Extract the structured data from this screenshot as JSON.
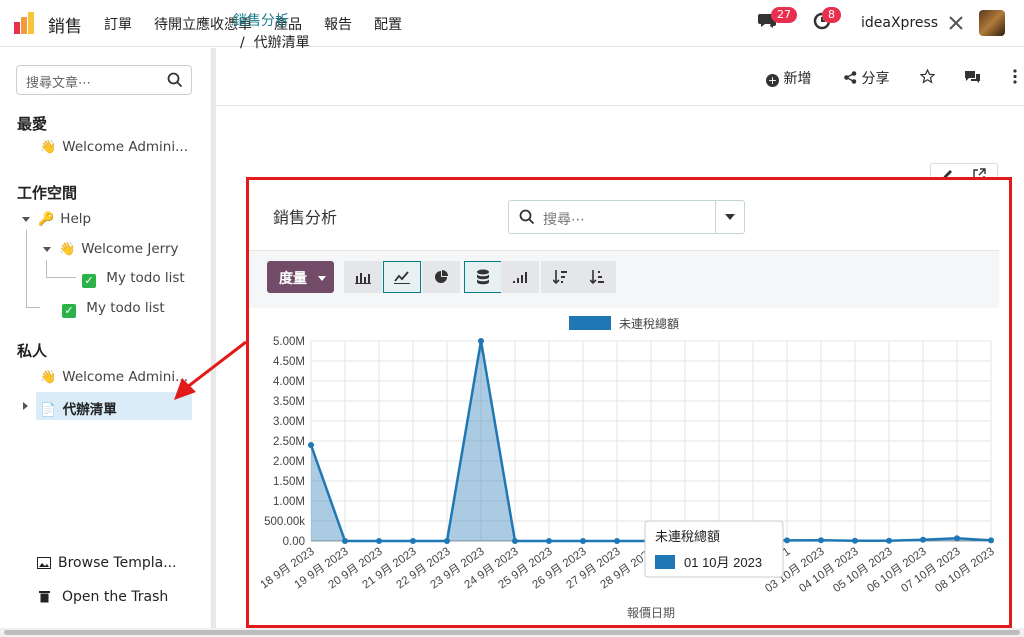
{
  "topbar": {
    "app_name": "銷售",
    "menu": [
      "訂單",
      "待開立應收憑單",
      "產品",
      "報告",
      "配置"
    ],
    "messages_count": "27",
    "activities_count": "8",
    "company": "ideaXpress"
  },
  "sidebar": {
    "search_placeholder": "搜尋文章⋯",
    "favorites_title": "最愛",
    "favorites": [
      {
        "icon": "👋",
        "label": "Welcome Admini..."
      }
    ],
    "workspace_title": "工作空間",
    "workspace": [
      {
        "icon": "🔑",
        "label": "Help"
      },
      {
        "icon": "👋",
        "label": "Welcome Jerry"
      },
      {
        "icon": "✅",
        "label": "My todo list"
      },
      {
        "icon": "✅",
        "label": "My todo list"
      }
    ],
    "private_title": "私人",
    "private": [
      {
        "icon": "👋",
        "label": "Welcome Admini..."
      },
      {
        "icon": "📄",
        "label": "代辦清單"
      }
    ],
    "browse_templates": "Browse Templa...",
    "open_trash": "Open the Trash"
  },
  "header": {
    "breadcrumb_parent": "銷售分析",
    "breadcrumb_current": "代辦清單",
    "new_label": "新增",
    "share_label": "分享"
  },
  "panel": {
    "title": "銷售分析",
    "search_placeholder": "搜尋⋯",
    "measure_label": "度量",
    "tooltip_title": "未連稅總額",
    "tooltip_value": "01 10月 2023"
  },
  "colors": {
    "series": "#1f77b4",
    "measure_button": "#714b67",
    "highlight": "#e31a1a",
    "breadcrumb": "#1a7f8c"
  },
  "chart_data": {
    "type": "area",
    "legend": "未連稅總額",
    "legend_position": "top-center",
    "xlabel": "報價日期",
    "ylabel": "",
    "ylim": [
      0,
      5000000
    ],
    "y_ticks": [
      "0.00",
      "500.00k",
      "1.00M",
      "1.50M",
      "2.00M",
      "2.50M",
      "3.00M",
      "3.50M",
      "4.00M",
      "4.50M",
      "5.00M"
    ],
    "categories": [
      "18 9月 2023",
      "19 9月 2023",
      "20 9月 2023",
      "21 9月 2023",
      "22 9月 2023",
      "23 9月 2023",
      "24 9月 2023",
      "25 9月 2023",
      "26 9月 2023",
      "27 9月 2023",
      "28 9月 2023",
      "29 9月 2023",
      "30 9月 2023",
      "01 10月 2023",
      "02 10月 2023",
      "03 10月 2023",
      "04 10月 2023",
      "05 10月 2023",
      "06 10月 2023",
      "07 10月 2023",
      "08 10月 2023"
    ],
    "x_tick_labels": [
      "18 9月 2023",
      "19 9月 2023",
      "20 9月 2023",
      "21 9月 2023",
      "22 9月 2023",
      "23 9月 2023",
      "24 9月 2023",
      "25 9月 2023",
      "26 9月 2023",
      "27 9月 2023",
      "28 9月 2023",
      "29",
      "",
      "01 1",
      "02 1",
      "03 10月 2023",
      "04 10月 2023",
      "05 10月 2023",
      "06 10月 2023",
      "07 10月 2023",
      "08 10月 2023"
    ],
    "series": [
      {
        "name": "未連稅總額",
        "values": [
          2400000,
          0,
          0,
          0,
          0,
          5000000,
          0,
          0,
          0,
          0,
          0,
          0,
          0,
          10000,
          15000,
          20000,
          5000,
          5000,
          30000,
          70000,
          15000
        ]
      }
    ],
    "grid": true
  }
}
